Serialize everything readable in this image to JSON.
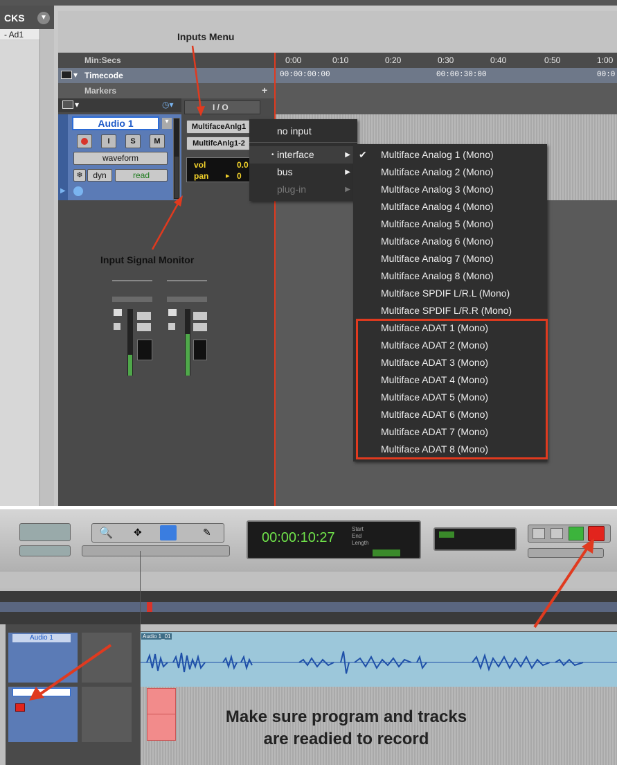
{
  "top_panel": {
    "tracks_header": "CKS",
    "track_list_item": "Ad1",
    "rulers": {
      "minsecs_label": "Min:Secs",
      "timecode_label": "Timecode",
      "markers_label": "Markers",
      "ticks": [
        "0:00",
        "0:10",
        "0:20",
        "0:30",
        "0:40",
        "0:50",
        "1:00"
      ],
      "tc_start": "00:00:00:00",
      "tc_mid": "00:00:30:00",
      "tc_end": "00:0"
    },
    "io_header": "I / O",
    "track": {
      "name": "Audio 1",
      "view": "waveform",
      "dyn": "dyn",
      "automation": "read",
      "input_button": "MultifaceAnlg1",
      "output_button": "MultifcAnlg1-2",
      "vol_label": "vol",
      "vol_value": "0.0",
      "pan_label": "pan",
      "pan_value": "0"
    },
    "annotations": {
      "inputs_menu": "Inputs Menu",
      "input_signal_monitor": "Input Signal Monitor"
    },
    "input_menu": {
      "items": [
        "no input",
        "interface",
        "bus",
        "plug-in"
      ]
    },
    "interface_submenu": {
      "items": [
        "Multiface Analog 1 (Mono)",
        "Multiface Analog 2 (Mono)",
        "Multiface Analog 3 (Mono)",
        "Multiface Analog 4 (Mono)",
        "Multiface Analog 5 (Mono)",
        "Multiface Analog 6 (Mono)",
        "Multiface Analog 7 (Mono)",
        "Multiface Analog 8 (Mono)",
        "Multiface SPDIF L/R.L (Mono)",
        "Multiface SPDIF L/R.R (Mono)",
        "Multiface ADAT 1 (Mono)",
        "Multiface ADAT 2 (Mono)",
        "Multiface ADAT 3 (Mono)",
        "Multiface ADAT 4 (Mono)",
        "Multiface ADAT 5 (Mono)",
        "Multiface ADAT 6 (Mono)",
        "Multiface ADAT 7 (Mono)",
        "Multiface ADAT 8 (Mono)"
      ],
      "checked_item": "Multiface Analog 1 (Mono)"
    }
  },
  "bottom_panel": {
    "counter": "00:00:10:27",
    "counter_labels": [
      "Start",
      "End",
      "Length"
    ],
    "track_name": "Audio 1",
    "region_name": "Audio 1_01",
    "caption_line1": "Make sure program and tracks",
    "caption_line2": "are readied to record"
  },
  "colors": {
    "record_red": "#d8342a",
    "highlight_box": "#e03a1f",
    "waveform_bg": "#9cc7da",
    "track_name_blue": "#1e5ac8"
  }
}
